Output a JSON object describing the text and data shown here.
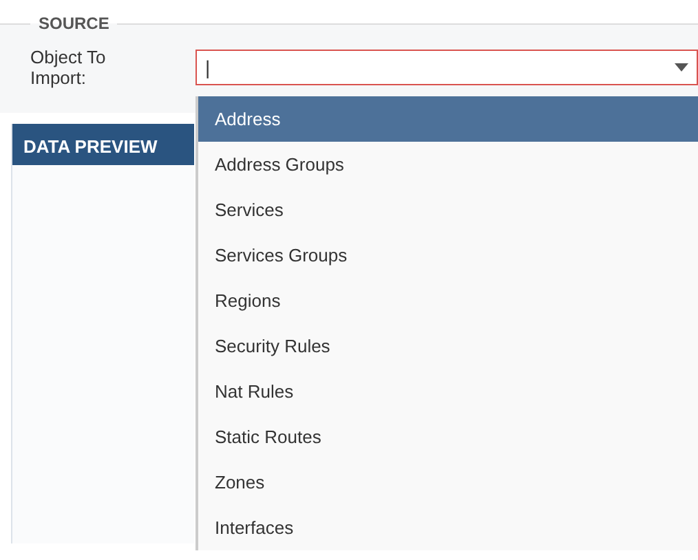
{
  "source": {
    "legend": "SOURCE",
    "label": "Object To Import:",
    "value": "|"
  },
  "data_preview": {
    "title": "DATA PREVIEW"
  },
  "options": [
    {
      "label": "Address",
      "selected": true
    },
    {
      "label": "Address Groups",
      "selected": false
    },
    {
      "label": "Services",
      "selected": false
    },
    {
      "label": "Services Groups",
      "selected": false
    },
    {
      "label": "Regions",
      "selected": false
    },
    {
      "label": "Security Rules",
      "selected": false
    },
    {
      "label": "Nat Rules",
      "selected": false
    },
    {
      "label": "Static Routes",
      "selected": false
    },
    {
      "label": "Zones",
      "selected": false
    },
    {
      "label": "Interfaces",
      "selected": false
    }
  ]
}
